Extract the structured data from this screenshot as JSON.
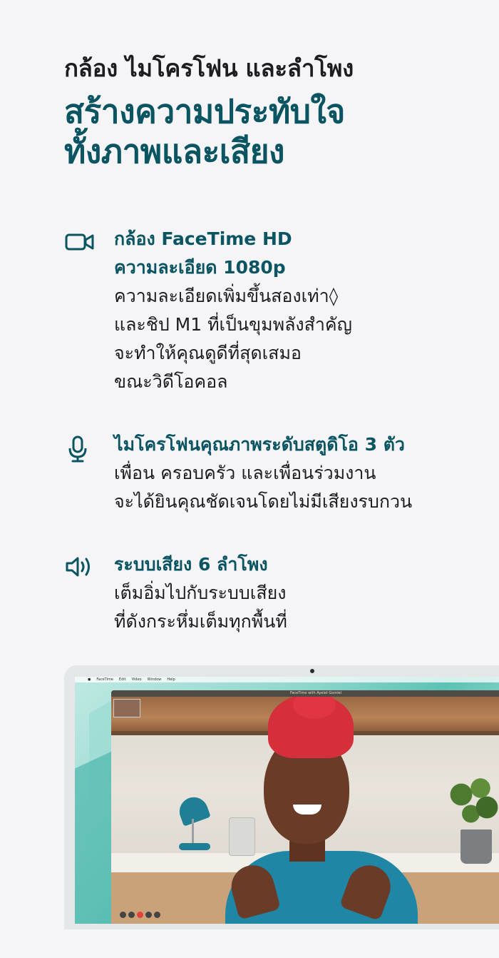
{
  "header": {
    "eyebrow": "กล้อง ไมโครโฟน และลำโพง",
    "headline_line1": "สร้างความประทับใจ",
    "headline_line2": "ทั้งภาพและเสียง"
  },
  "features": [
    {
      "icon": "video-camera-icon",
      "title_line1": "กล้อง FaceTime HD",
      "title_line2": "ความละเอียด 1080p",
      "body": [
        "ความละเอียดเพิ่มขึ้นสองเท่า◊",
        "และชิป M1 ที่เป็นขุมพลังสำคัญ",
        "จะทำให้คุณดูดีที่สุดเสมอ",
        "ขณะวิดีโอคอล"
      ]
    },
    {
      "icon": "microphone-icon",
      "title_line1": "ไมโครโฟนคุณภาพระดับสตูดิโอ 3 ตัว",
      "body": [
        "เพื่อน ครอบครัว และเพื่อนร่วมงาน",
        "จะได้ยินคุณชัดเจนโดยไม่มีเสียงรบกวน"
      ]
    },
    {
      "icon": "speaker-icon",
      "title_line1": "ระบบเสียง 6 ลำโพง",
      "body": [
        "เต็มอิ่มไปกับระบบเสียง",
        "ที่ดังกระหึ่มเต็มทุกพื้นที่"
      ]
    }
  ],
  "device": {
    "menubar": [
      "FaceTime",
      "Edit",
      "Video",
      "Window",
      "Help"
    ],
    "window_title": "FaceTime with Ayelet Gomiel"
  },
  "colors": {
    "accent": "#0b5563",
    "text": "#1d1d1f",
    "background": "#f5f5f7"
  }
}
